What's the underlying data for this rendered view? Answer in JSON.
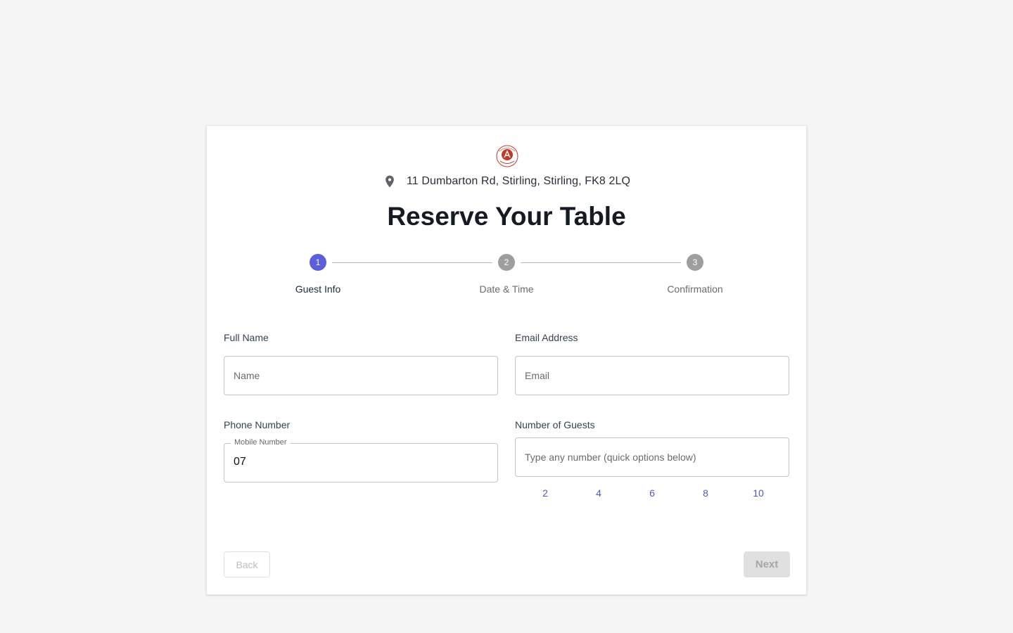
{
  "header": {
    "address": "11 Dumbarton Rd, Stirling, Stirling, FK8 2LQ",
    "title": "Reserve Your Table"
  },
  "steps": [
    {
      "number": "1",
      "label": "Guest Info",
      "state": "active"
    },
    {
      "number": "2",
      "label": "Date & Time",
      "state": "inactive"
    },
    {
      "number": "3",
      "label": "Confirmation",
      "state": "inactive"
    }
  ],
  "form": {
    "full_name": {
      "label": "Full Name",
      "placeholder": "Name",
      "value": ""
    },
    "email": {
      "label": "Email Address",
      "placeholder": "Email",
      "value": ""
    },
    "phone": {
      "label": "Phone Number",
      "field_legend": "Mobile Number",
      "value": "07"
    },
    "guests": {
      "label": "Number of Guests",
      "placeholder": "Type any number (quick options below)",
      "quick_options": [
        "2",
        "4",
        "6",
        "8",
        "10"
      ]
    }
  },
  "actions": {
    "back_label": "Back",
    "next_label": "Next"
  },
  "colors": {
    "accent": "#5B5FDE",
    "inactive_step": "#9E9E9E",
    "quick_option": "#5058C7",
    "logo_red": "#C0392B"
  }
}
